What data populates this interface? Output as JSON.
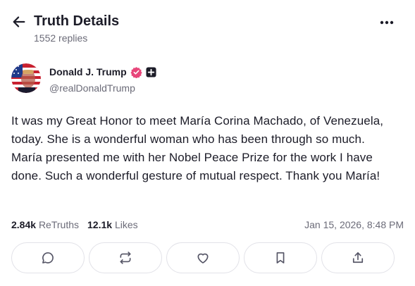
{
  "header": {
    "title": "Truth Details",
    "replies": "1552 replies"
  },
  "author": {
    "name": "Donald J. Trump",
    "handle": "@realDonaldTrump",
    "verified_color": "#e8457a"
  },
  "post": {
    "text": "It was my Great Honor to meet María Corina Machado, of Venezuela, today. She is a wonderful woman who has been through so much. María presented me with her Nobel Peace Prize for the work I have done. Such a wonderful gesture of mutual respect. Thank you María!"
  },
  "stats": {
    "retruths_count": "2.84k",
    "retruths_label": "ReTruths",
    "likes_count": "12.1k",
    "likes_label": "Likes",
    "timestamp": "Jan 15, 2026, 8:48 PM"
  },
  "actions": [
    "reply-icon",
    "retruth-icon",
    "like-icon",
    "bookmark-icon",
    "share-icon"
  ]
}
